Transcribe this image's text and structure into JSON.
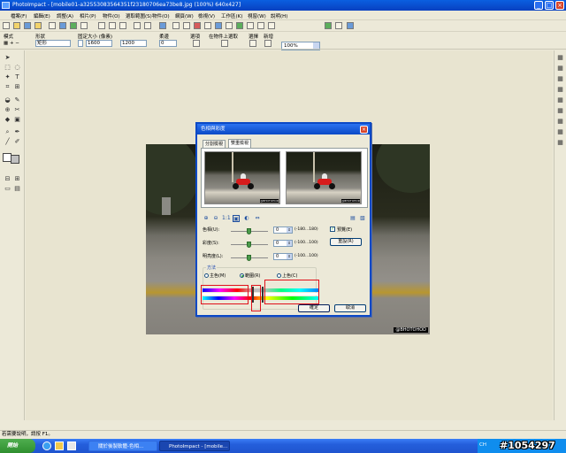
{
  "window": {
    "title": "PhotoImpact - [mobile01-a32553083564351f23180706ea73be8.jpg (100%) 640x427]",
    "controls": [
      "_",
      "□",
      "×"
    ]
  },
  "menu": [
    "檔案(F)",
    "編輯(E)",
    "調整(A)",
    "相片(P)",
    "物件(O)",
    "選取範圍(S)",
    "物件(O)",
    "網頁(W)",
    "檢視(V)",
    "工作區(K)",
    "視窗(W)",
    "說明(H)"
  ],
  "toolbar": {
    "zoom": "100%"
  },
  "options_bar": {
    "mode_label": "模式",
    "shape_label": "形狀",
    "shape_value": "矩形",
    "fixed_size_label": "固定大小 (像素)",
    "width_value": "1600",
    "height_value": "1200",
    "soft_edge_label": "柔邊",
    "soft_edge_value": "0",
    "options_label": "選項",
    "align_label": "對齊",
    "on_object_label": "在物件上選取",
    "select_label": "選擇",
    "new_label": "新增"
  },
  "dialog": {
    "title": "色相與彩度",
    "close": "×",
    "tabs": [
      "分割檢視",
      "雙重檢視"
    ],
    "active_tab": 1,
    "sliders": [
      {
        "label": "色相(U):",
        "value": "0",
        "range": "(-180...180)"
      },
      {
        "label": "彩度(S):",
        "value": "0",
        "range": "(-100...100)"
      },
      {
        "label": "明亮度(L):",
        "value": "0",
        "range": "(-100...100)"
      }
    ],
    "preview_check": "預覽(E)",
    "preview_checked": true,
    "reset_button": "重設(R)",
    "method_group": "方法",
    "radios": [
      "主色(M)",
      "範圍(R)",
      "上色(C)"
    ],
    "selected_radio": 1,
    "ok_button": "確定",
    "cancel_button": "取消"
  },
  "photo_stamp": "@BHOTOHOD",
  "preview_stamp": "@BHOTOHOD",
  "statusbar": "若需要說明，請按 F1。",
  "taskbar": {
    "start": "開始",
    "tasks": [
      "關於後製軟體-色相...",
      "PhotoImpact - [mobile..."
    ],
    "tray_time": "CH"
  },
  "watermark": "#1054297"
}
